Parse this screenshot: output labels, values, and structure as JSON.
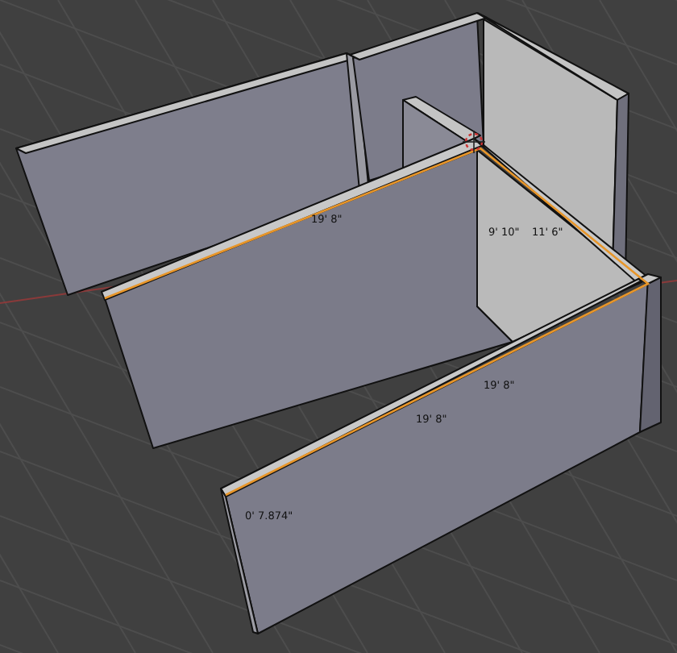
{
  "viewport": {
    "dimension_labels": [
      {
        "text": "19' 8\""
      },
      {
        "text": "9' 10\""
      },
      {
        "text": "11' 6\""
      },
      {
        "text": "19' 8\""
      },
      {
        "text": "19' 8\""
      },
      {
        "text": "0' 7.874\""
      }
    ]
  }
}
